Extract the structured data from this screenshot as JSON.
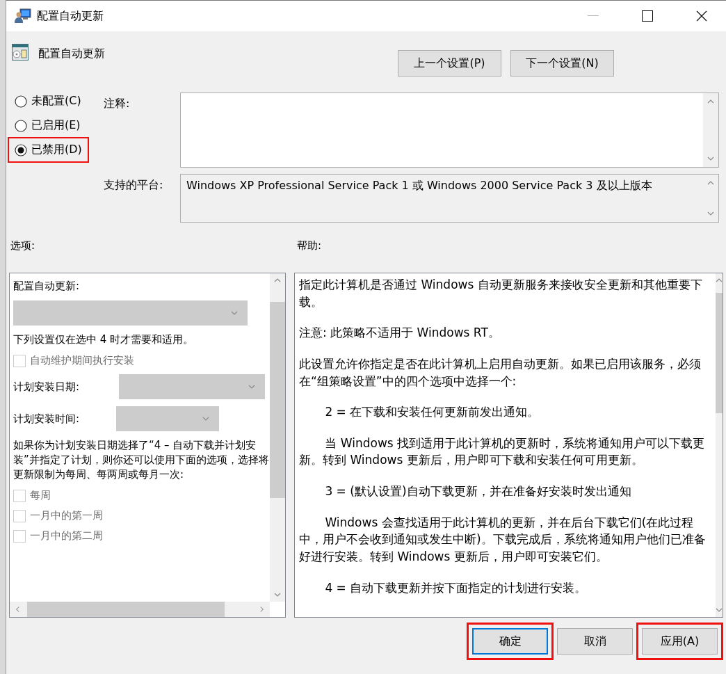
{
  "window": {
    "title": "配置自动更新"
  },
  "header": {
    "title": "配置自动更新",
    "buttons": [
      {
        "label": "上一个设置(P)"
      },
      {
        "label": "下一个设置(N)"
      }
    ]
  },
  "state_options": [
    {
      "label": "未配置(C)",
      "selected": false,
      "highlighted": false
    },
    {
      "label": "已启用(E)",
      "selected": false,
      "highlighted": false
    },
    {
      "label": "已禁用(D)",
      "selected": true,
      "highlighted": true
    }
  ],
  "comment": {
    "label": "注释:"
  },
  "platform": {
    "label": "支持的平台:",
    "value": "Windows XP Professional Service Pack 1 或 Windows 2000 Service Pack 3 及以上版本"
  },
  "options": {
    "label": "选项:",
    "items": [
      {
        "kind": "text",
        "text": "配置自动更新:"
      },
      {
        "kind": "dropdown",
        "disabled": true
      },
      {
        "kind": "text",
        "text": "下列设置仅在选中 4 时才需要和适用。"
      },
      {
        "kind": "checkbox",
        "text": "自动维护期间执行安装",
        "checked": false,
        "disabled": true
      },
      {
        "kind": "labeled_dropdown",
        "text": "计划安装日期:",
        "disabled": true,
        "wide": true
      },
      {
        "kind": "labeled_dropdown",
        "text": "计划安装时间:",
        "disabled": true,
        "wide": false
      },
      {
        "kind": "text",
        "text": "如果你为计划安装日期选择了“4 – 自动下载并计划安装”并指定了计划，则你还可以使用下面的选项，选择将更新限制为每周、每两周或每月一次:"
      },
      {
        "kind": "checkbox",
        "text": "每周",
        "checked": false,
        "disabled": true
      },
      {
        "kind": "checkbox",
        "text": "一月中的第一周",
        "checked": false,
        "disabled": true
      },
      {
        "kind": "checkbox",
        "text": "一月中的第二周",
        "checked": false,
        "disabled": true
      }
    ]
  },
  "help": {
    "label": "帮助:",
    "paragraphs": [
      {
        "text": "指定此计算机是否通过 Windows 自动更新服务来接收安全更新和其他重要下载。",
        "indented": false
      },
      {
        "text": "注意: 此策略不适用于 Windows RT。",
        "indented": false
      },
      {
        "text": "此设置允许你指定是否在此计算机上启用自动更新。如果已启用该服务，必须在“组策略设置”中的四个选项中选择一个:",
        "indented": false
      },
      {
        "text": "2 = 在下载和安装任何更新前发出通知。",
        "indented": true
      },
      {
        "text": "当 Windows 找到适用于此计算机的更新时，系统将通知用户可以下载更新。转到 Windows 更新后，用户即可下载和安装任何可用更新。",
        "indented": true
      },
      {
        "text": "3 = (默认设置)自动下载更新，并在准备好安装时发出通知",
        "indented": true
      },
      {
        "text": "Windows 会查找适用于此计算机的更新，并在后台下载它们(在此过程中，用户不会收到通知或发生中断)。下载完成后，系统将通知用户他们已准备好进行安装。转到 Windows 更新后，用户即可安装它们。",
        "indented": true
      },
      {
        "text": "4 = 自动下载更新并按下面指定的计划进行安装。",
        "indented": true
      }
    ]
  },
  "footer_buttons": [
    {
      "label": "确定",
      "default": true,
      "highlighted": true
    },
    {
      "label": "取消",
      "default": false,
      "highlighted": false
    },
    {
      "label": "应用(A)",
      "default": false,
      "highlighted": true
    }
  ]
}
